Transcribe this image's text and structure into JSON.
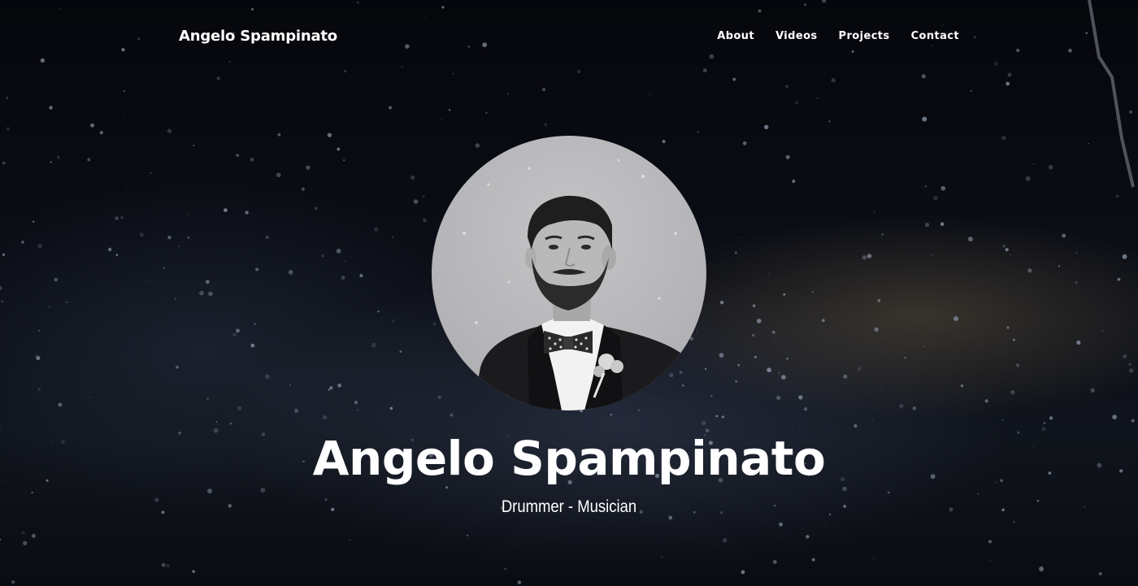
{
  "navbar": {
    "brand": "Angelo Spampinato",
    "links": [
      {
        "label": "About"
      },
      {
        "label": "Videos"
      },
      {
        "label": "Projects"
      },
      {
        "label": "Contact"
      }
    ]
  },
  "hero": {
    "title": "Angelo Spampinato",
    "subtitle": "Drummer - Musician",
    "background": "dark-water-droplets-cymbal-photo",
    "portrait": "black-and-white-portrait-photo"
  },
  "colors": {
    "text": "#ffffff",
    "background": "#05060a",
    "portrait_bg": "#b8b8bb"
  }
}
